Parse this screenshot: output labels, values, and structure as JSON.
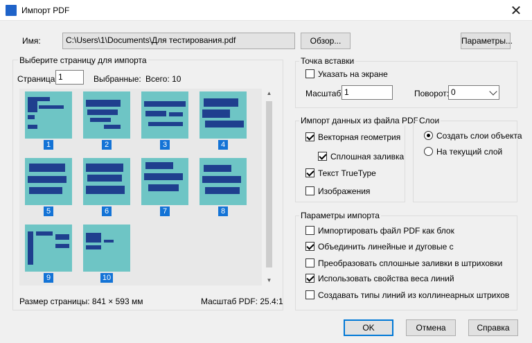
{
  "window": {
    "title": "Импорт PDF",
    "close_label": "✕"
  },
  "file": {
    "label": "Имя:",
    "path": "C:\\Users\\1\\Documents\\Для тестирования.pdf",
    "browse_label": "Обзор...",
    "params_label": "Параметры..."
  },
  "pages": {
    "legend": "Выберите страницу для импорта",
    "page_label": "Страница:",
    "page_value": "1",
    "selected_label": "Выбранные:",
    "total_label": "Всего: 10",
    "numbers": [
      "1",
      "2",
      "3",
      "4",
      "5",
      "6",
      "7",
      "8",
      "9",
      "10"
    ],
    "page_size": "Размер страницы: 841 × 593 мм",
    "pdf_scale": "Масштаб PDF: 25.4:1"
  },
  "insert_point": {
    "legend": "Точка вставки",
    "specify_on_screen": "Указать на экране",
    "scale_label": "Масштаб:",
    "scale_value": "1",
    "rotation_label": "Поворот:",
    "rotation_value": "0"
  },
  "import_data": {
    "legend": "Импорт данных из файла PDF",
    "vector_geometry": "Векторная геометрия",
    "solid_fill": "Сплошная заливка",
    "truetype_text": "Текст TrueType",
    "images": "Изображения"
  },
  "layers": {
    "legend": "Слои",
    "create_object_layers": "Создать слои объекта",
    "current_layer": "На текущий слой"
  },
  "import_options": {
    "legend": "Параметры импорта",
    "as_block": "Импортировать файл PDF как блок",
    "join_segments": "Объединить линейные и дуговые с",
    "fills_to_hatches": "Преобразовать сплошные заливки в штриховки",
    "lineweights": "Использовать свойства веса линий",
    "linetypes": "Создавать типы линий из коллинеарных штрихов"
  },
  "footer": {
    "ok": "OK",
    "cancel": "Отмена",
    "help": "Справка"
  },
  "colors": {
    "accent": "#0078d7",
    "thumb_bg": "#6ec5c5",
    "thumb_fg": "#1f3f8e",
    "selection": "#1373d6"
  }
}
